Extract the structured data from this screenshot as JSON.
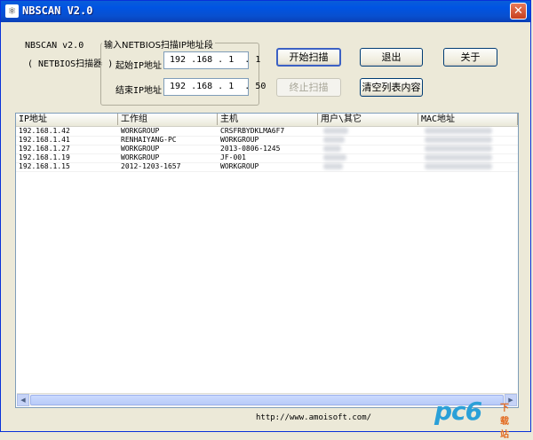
{
  "window": {
    "title": "NBSCAN V2.0",
    "close_glyph": "✕"
  },
  "about": {
    "line1": "NBSCAN v2.0",
    "line2": "( NETBIOS扫描器 )"
  },
  "range_group": {
    "title": "输入NETBIOS扫描IP地址段",
    "start_label": "起始IP地址",
    "start_ip": "192 .168 . 1  . 1",
    "end_label": "结束IP地址",
    "end_ip": "192 .168 . 1  . 50"
  },
  "buttons": {
    "start": "开始扫描",
    "exit": "退出",
    "about": "关于",
    "stop": "终止扫描",
    "clear": "清空列表内容"
  },
  "list": {
    "columns": [
      "IP地址",
      "工作组",
      "主机",
      "用户\\其它",
      "MAC地址"
    ],
    "rows": [
      [
        "192.168.1.42",
        "WORKGROUP",
        "CRSFRBYDKLMA6F7"
      ],
      [
        "192.168.1.41",
        "RENHAIYANG-PC",
        "WORKGROUP"
      ],
      [
        "192.168.1.27",
        "WORKGROUP",
        "2013-0806-1245"
      ],
      [
        "192.168.1.19",
        "WORKGROUP",
        "JF-001"
      ],
      [
        "192.168.1.15",
        "2012-1203-1657",
        "WORKGROUP"
      ]
    ]
  },
  "footer": {
    "url": "http://www.amoisoft.com/",
    "watermark": "pc6",
    "watermark_sub": "下载站"
  },
  "icons": {
    "app": "app-icon",
    "close": "close-icon"
  },
  "colors": {
    "titlebar": "#0054e3",
    "window_bg": "#ece9d8"
  }
}
